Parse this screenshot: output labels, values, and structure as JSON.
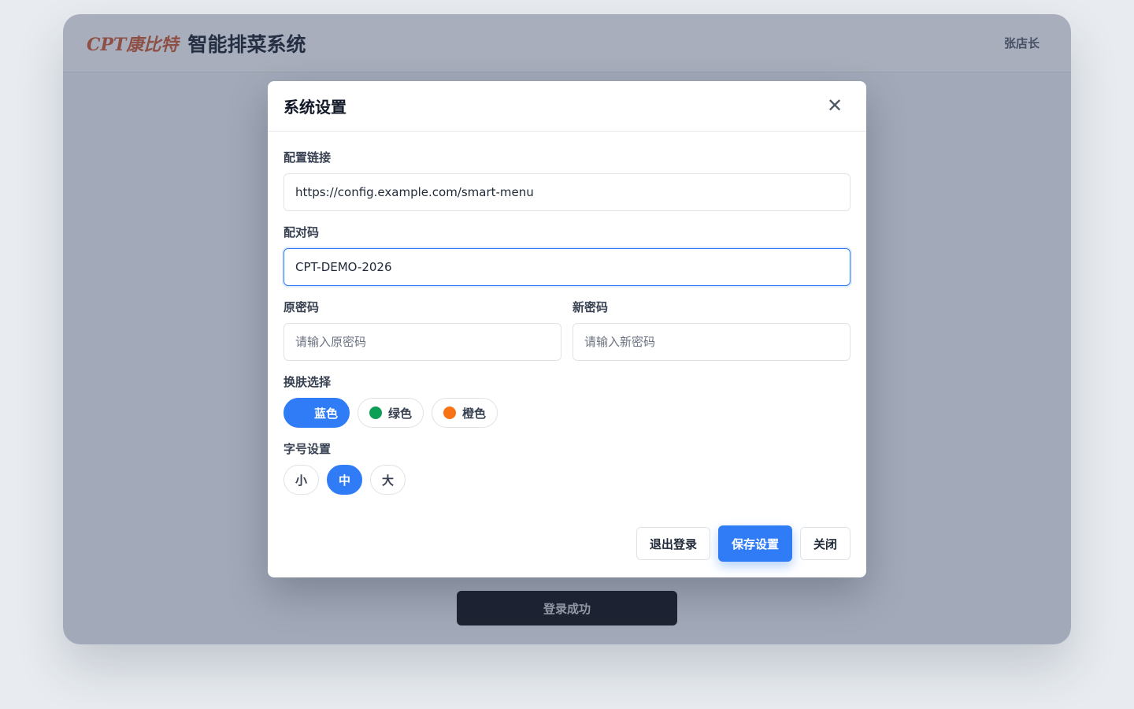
{
  "header": {
    "logo_text": "CPT康比特",
    "app_title": "智能排菜系统",
    "user_name": "张店长"
  },
  "toast": {
    "message": "登录成功"
  },
  "modal": {
    "title": "系统设置",
    "config_link": {
      "label": "配置链接",
      "value": "https://config.example.com/smart-menu"
    },
    "pair_code": {
      "label": "配对码",
      "value": "CPT-DEMO-2026"
    },
    "old_password": {
      "label": "原密码",
      "placeholder": "请输入原密码"
    },
    "new_password": {
      "label": "新密码",
      "placeholder": "请输入新密码"
    },
    "theme": {
      "label": "换肤选择",
      "options": [
        {
          "label": "蓝色",
          "color": "#2f7cf6",
          "selected": true
        },
        {
          "label": "绿色",
          "color": "#0e9f57",
          "selected": false
        },
        {
          "label": "橙色",
          "color": "#f97316",
          "selected": false
        }
      ]
    },
    "font_size": {
      "label": "字号设置",
      "options": [
        {
          "label": "小",
          "selected": false
        },
        {
          "label": "中",
          "selected": true
        },
        {
          "label": "大",
          "selected": false
        }
      ]
    },
    "footer": {
      "logout_label": "退出登录",
      "save_label": "保存设置",
      "close_label": "关闭"
    }
  },
  "colors": {
    "accent": "#2f7cf6",
    "logo": "#d0552b",
    "overlay": "#3f4c68"
  }
}
